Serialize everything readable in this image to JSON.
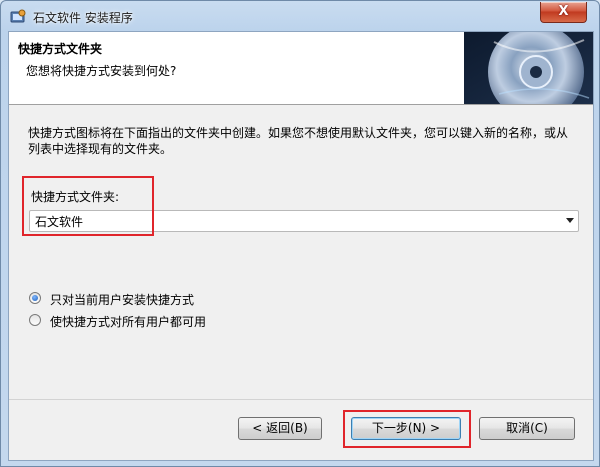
{
  "window": {
    "title": "石文软件 安装程序",
    "close_glyph": "X"
  },
  "header": {
    "title": "快捷方式文件夹",
    "subtitle": "您想将快捷方式安装到何处?"
  },
  "main": {
    "description": "快捷方式图标将在下面指出的文件夹中创建。如果您不想使用默认文件夹，您可以键入新的名称，或从列表中选择现有的文件夹。",
    "folder_label": "快捷方式文件夹:",
    "folder_value": "石文软件",
    "options": [
      {
        "label": "只对当前用户安装快捷方式",
        "checked": true
      },
      {
        "label": "使快捷方式对所有用户都可用",
        "checked": false
      }
    ]
  },
  "buttons": {
    "back": "< 返回(B)",
    "next": "下一步(N) >",
    "cancel": "取消(C)"
  },
  "colors": {
    "highlight": "#e0252b",
    "accent": "#1f5fb8"
  }
}
